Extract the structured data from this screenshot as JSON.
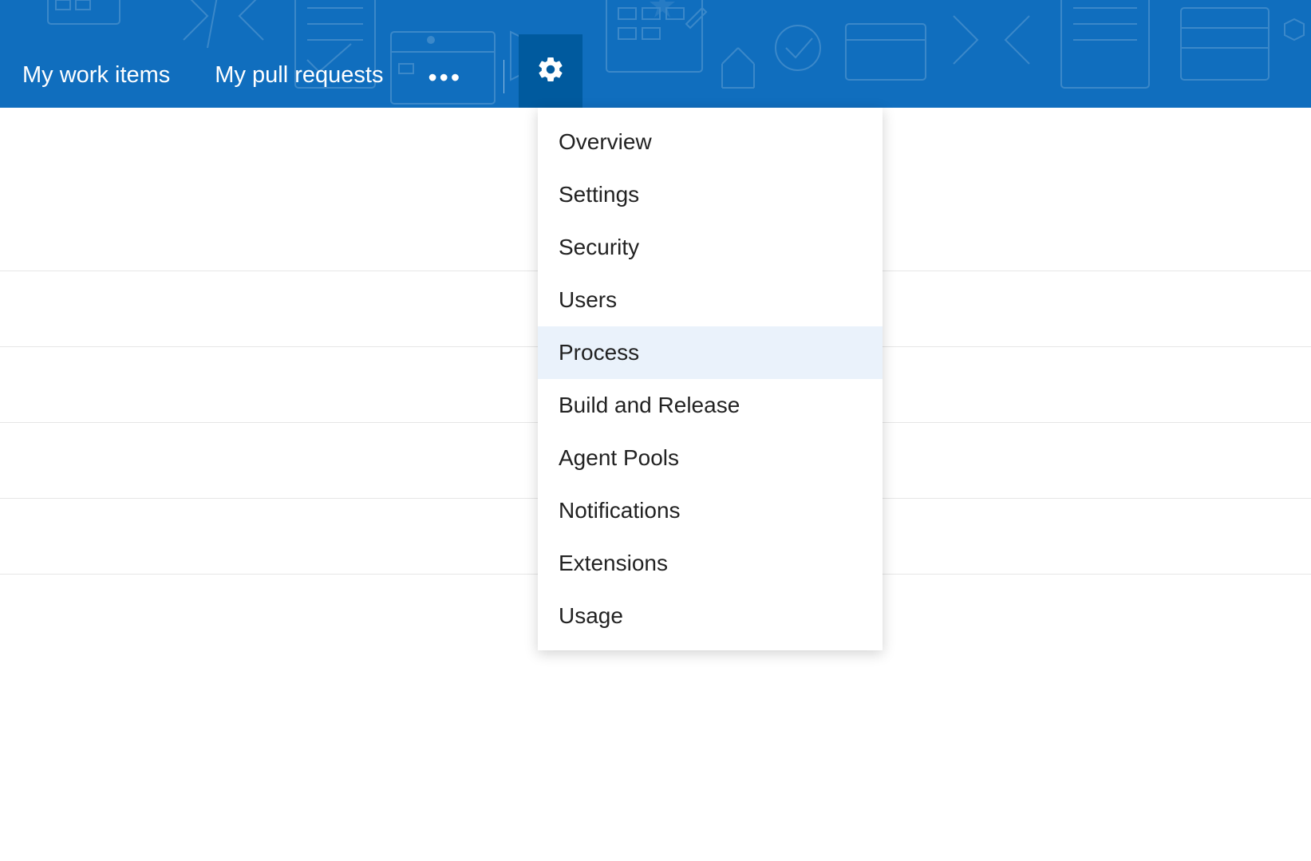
{
  "header": {
    "nav": [
      {
        "label": "My work items"
      },
      {
        "label": "My pull requests"
      }
    ],
    "more_glyph": "•••"
  },
  "settings_menu": {
    "items": [
      {
        "label": "Overview",
        "highlight": false
      },
      {
        "label": "Settings",
        "highlight": false
      },
      {
        "label": "Security",
        "highlight": false
      },
      {
        "label": "Users",
        "highlight": false
      },
      {
        "label": "Process",
        "highlight": true
      },
      {
        "label": "Build and Release",
        "highlight": false
      },
      {
        "label": "Agent Pools",
        "highlight": false
      },
      {
        "label": "Notifications",
        "highlight": false
      },
      {
        "label": "Extensions",
        "highlight": false
      },
      {
        "label": "Usage",
        "highlight": false
      }
    ]
  },
  "colors": {
    "header_bg": "#106ebe",
    "gear_bg": "#005a9e",
    "highlight_bg": "#eaf2fb"
  }
}
